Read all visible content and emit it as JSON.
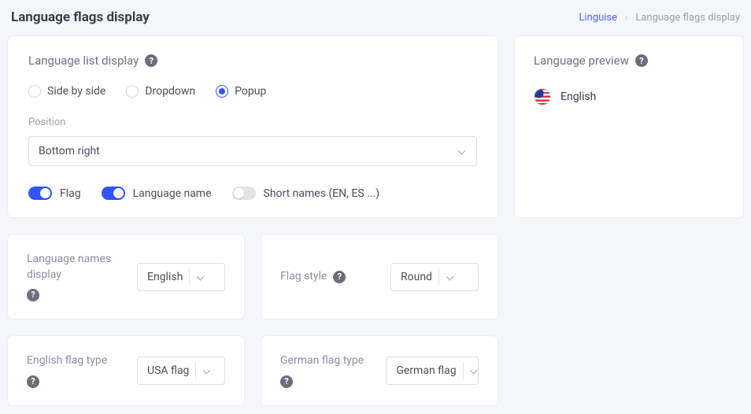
{
  "header": {
    "title": "Language flags display",
    "breadcrumb_root": "Linguise",
    "breadcrumb_current": "Language flags display"
  },
  "list_display": {
    "title": "Language list display",
    "options": {
      "side": "Side by side",
      "dropdown": "Dropdown",
      "popup": "Popup"
    },
    "selected": "popup",
    "position_label": "Position",
    "position_value": "Bottom right",
    "toggles": {
      "flag": {
        "label": "Flag",
        "on": true
      },
      "language_name": {
        "label": "Language name",
        "on": true
      },
      "short_names": {
        "label": "Short names (EN, ES ...)",
        "on": false
      }
    }
  },
  "preview": {
    "title": "Language preview",
    "language_text": "English"
  },
  "names_display": {
    "label": "Language names display",
    "value": "English"
  },
  "flag_style": {
    "label": "Flag style",
    "value": "Round"
  },
  "english_flag": {
    "label": "English flag type",
    "value": "USA flag"
  },
  "german_flag": {
    "label": "German flag type",
    "value": "German flag"
  }
}
